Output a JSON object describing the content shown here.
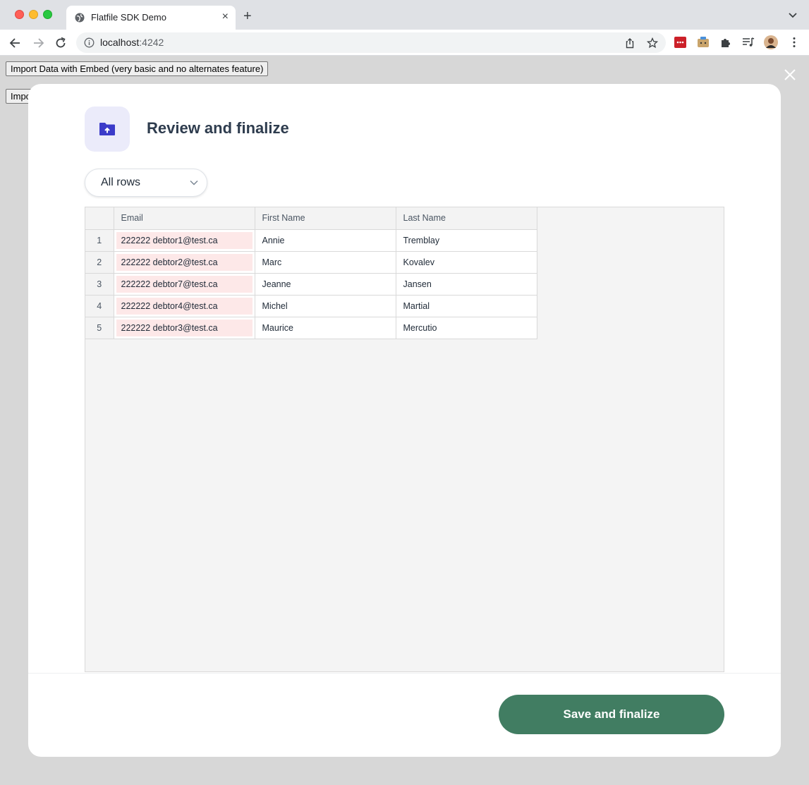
{
  "browser": {
    "tab_title": "Flatfile SDK Demo",
    "new_tab_symbol": "+",
    "tab_close_symbol": "×",
    "url_host": "localhost",
    "url_port": ":4242"
  },
  "page": {
    "buttons": [
      {
        "label": "Import Data with Embed (very basic and no alternates feature)"
      },
      {
        "label": "Impo"
      }
    ]
  },
  "modal": {
    "title": "Review and finalize",
    "filter": {
      "selected": "All rows"
    },
    "table": {
      "columns": [
        "Email",
        "First Name",
        "Last Name"
      ],
      "rows": [
        {
          "num": "1",
          "email": "222222 debtor1@test.ca",
          "first": "Annie",
          "last": "Tremblay"
        },
        {
          "num": "2",
          "email": "222222 debtor2@test.ca",
          "first": "Marc",
          "last": "Kovalev"
        },
        {
          "num": "3",
          "email": "222222 debtor7@test.ca",
          "first": "Jeanne",
          "last": "Jansen"
        },
        {
          "num": "4",
          "email": "222222 debtor4@test.ca",
          "first": "Michel",
          "last": "Martial"
        },
        {
          "num": "5",
          "email": "222222 debtor3@test.ca",
          "first": "Maurice",
          "last": "Mercutio"
        }
      ]
    },
    "save_button": "Save and finalize"
  },
  "colors": {
    "accent": "#417d62",
    "error_cell": "#fde8e8",
    "icon_tile": "#ebebfa",
    "icon": "#3b3bc9"
  }
}
